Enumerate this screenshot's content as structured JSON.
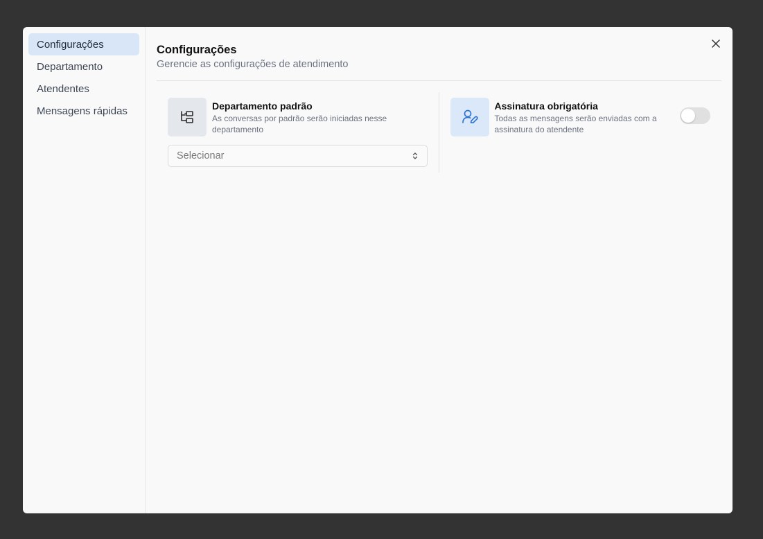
{
  "sidebar": {
    "items": [
      {
        "label": "Configurações",
        "active": true
      },
      {
        "label": "Departamento"
      },
      {
        "label": "Atendentes"
      },
      {
        "label": "Mensagens rápidas"
      }
    ]
  },
  "header": {
    "title": "Configurações",
    "subtitle": "Gerencie as configurações de atendimento"
  },
  "settings": {
    "department": {
      "title": "Departamento padrão",
      "description": "As conversas por padrão serão iniciadas nesse departamento",
      "select_placeholder": "Selecionar",
      "icon": "hierarchy-icon"
    },
    "signature": {
      "title": "Assinatura obrigatória",
      "description": "Todas as mensagens serão enviadas com a assinatura do atendente",
      "enabled": false,
      "icon": "user-pen-icon"
    }
  },
  "colors": {
    "overlay": "#333333",
    "active_item_bg": "#d9e6f7",
    "accent_blue": "#2f74d0"
  }
}
